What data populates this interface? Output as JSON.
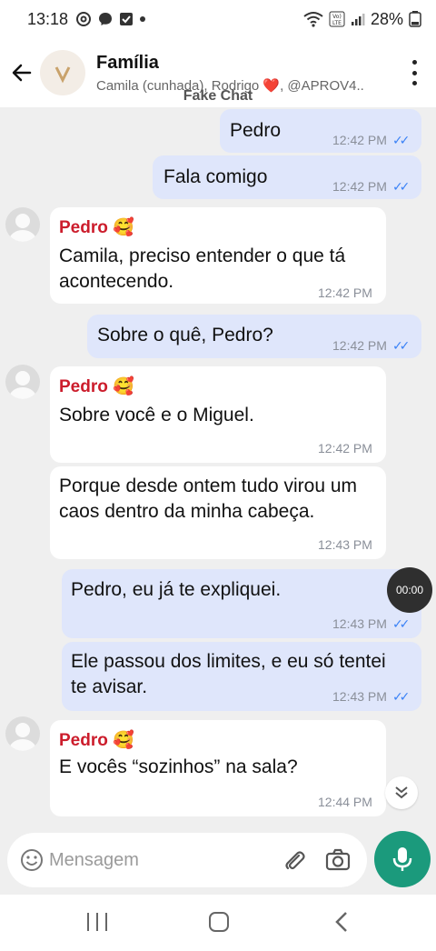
{
  "status_bar": {
    "time": "13:18",
    "battery": "28%",
    "icons": [
      "threads-icon",
      "messenger-icon",
      "check-square-icon",
      "dot-icon",
      "wifi-icon",
      "volte-icon",
      "signal-icon",
      "battery-icon"
    ]
  },
  "header": {
    "title": "Família",
    "subtitle": "Camila (cunhada), Rodrigo ❤️, @APROV4..",
    "watermark": "Fake Chat"
  },
  "messages": [
    {
      "dir": "out",
      "text": "Pedro",
      "time": "12:42 PM",
      "ticks": "✓✓"
    },
    {
      "dir": "out",
      "text": "Fala comigo",
      "time": "12:42 PM",
      "ticks": "✓✓"
    },
    {
      "dir": "in",
      "sender": "Pedro 🥰",
      "text": "Camila, preciso entender o que tá acontecendo.",
      "time": "12:42 PM"
    },
    {
      "dir": "out",
      "text": "Sobre o quê, Pedro?",
      "time": "12:42 PM",
      "ticks": "✓✓"
    },
    {
      "dir": "in",
      "sender": "Pedro 🥰",
      "text": "Sobre você e o Miguel.",
      "time": "12:42 PM"
    },
    {
      "dir": "in",
      "text": "Porque desde ontem tudo virou um caos dentro da minha cabeça.",
      "time": "12:43 PM"
    },
    {
      "dir": "out",
      "text": "Pedro, eu já te expliquei.",
      "time": "12:43 PM",
      "ticks": "✓✓"
    },
    {
      "dir": "out",
      "text": "Ele passou dos limites, e eu só tentei te avisar.",
      "time": "12:43 PM",
      "ticks": "✓✓"
    },
    {
      "dir": "in",
      "sender": "Pedro 🥰",
      "text": "E vocês “sozinhos” na sala?",
      "time": "12:44 PM"
    }
  ],
  "overlay": {
    "timer": "00:00",
    "scroll_down": "⌄⌄"
  },
  "composer": {
    "placeholder": "Mensagem"
  },
  "colors": {
    "outgoing_bubble": "#dfe6fb",
    "incoming_bubble": "#ffffff",
    "sender_name": "#cc1d2c",
    "mic_button": "#1b9a7c",
    "read_ticks": "#3b82f6"
  }
}
